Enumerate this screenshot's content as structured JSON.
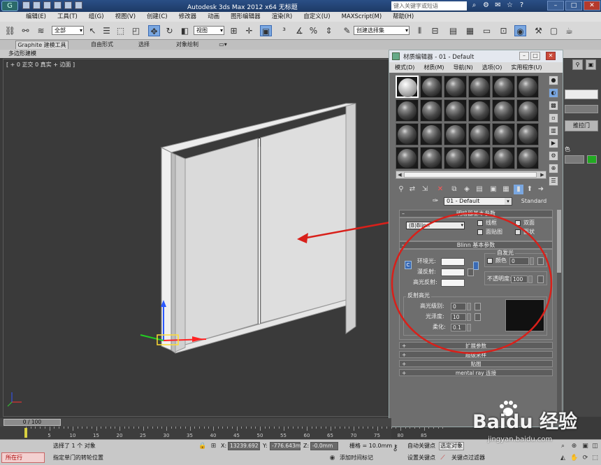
{
  "window": {
    "title": "Autodesk 3ds Max  2012 x64   无标题",
    "search_placeholder": "键入关键字或短语"
  },
  "menubar": {
    "items": [
      "编辑(E)",
      "工具(T)",
      "组(G)",
      "视图(V)",
      "创建(C)",
      "修改器",
      "动画",
      "图形编辑器",
      "渲染(R)",
      "自定义(U)",
      "MAXScript(M)",
      "帮助(H)"
    ]
  },
  "toolbar": {
    "selection_filter": "全部",
    "ref_coord": "视图",
    "named_selection": "创建选择集"
  },
  "ribbon": {
    "tabs": [
      "Graphite 建模工具",
      "自由形式",
      "选择",
      "对象绘制"
    ],
    "sub_label": "多边形建模"
  },
  "viewport": {
    "label": "[ + 0 正交 0 真实 + 边面 ]"
  },
  "command_panel": {
    "button_label": "推拉门",
    "color_label": "色",
    "object_color": "#22aa22"
  },
  "material_editor": {
    "title": "材质编辑器 - 01 - Default",
    "menus": [
      "模式(D)",
      "材质(M)",
      "导航(N)",
      "选项(O)",
      "实用程序(U)"
    ],
    "material_name": "01 - Default",
    "material_type": "Standard",
    "shader_rollout": {
      "title": "明暗器基本参数",
      "shader": "(B)Blinn",
      "options": [
        "线框",
        "双面",
        "面贴图",
        "面状"
      ]
    },
    "blinn_rollout": {
      "title": "Blinn 基本参数",
      "self_illum_title": "自发光",
      "color_label": "颜色",
      "self_illum_value": "0",
      "ambient_label": "环境光:",
      "diffuse_label": "漫反射:",
      "specular_label": "高光反射:",
      "opacity_label": "不透明度:",
      "opacity_value": "100",
      "highlights_title": "反射高光",
      "spec_level_label": "高光级别:",
      "spec_level_value": "0",
      "gloss_label": "光泽度:",
      "gloss_value": "10",
      "soften_label": "柔化:",
      "soften_value": "0.1"
    },
    "collapsed_rollouts": [
      "扩展参数",
      "超级采样",
      "贴图",
      "mental ray 连接"
    ]
  },
  "timeline": {
    "slider_text": "0 / 100",
    "ticks": [
      0,
      5,
      10,
      15,
      20,
      25,
      30,
      35,
      40,
      45,
      50,
      55,
      60,
      65,
      70,
      75,
      80,
      85
    ]
  },
  "status": {
    "mode_badge": "所在行",
    "selection_text": "选择了 1 个 对象",
    "prompt_text": "指定单门的转轮位置",
    "x_label": "X:",
    "x_value": "13239.692",
    "y_label": "Y:",
    "y_value": "-776.643m",
    "z_label": "Z:",
    "z_value": "-0.0mm",
    "grid_text": "栅格 = 10.0mm",
    "add_time_tag": "添加时间标记",
    "auto_key": "自动关键点",
    "set_key": "设置关键点",
    "selected_objects": "选定对象",
    "key_filters": "关键点过滤器"
  },
  "watermark": {
    "text": "Baidu 经验",
    "url": "jingyan.baidu.com"
  }
}
